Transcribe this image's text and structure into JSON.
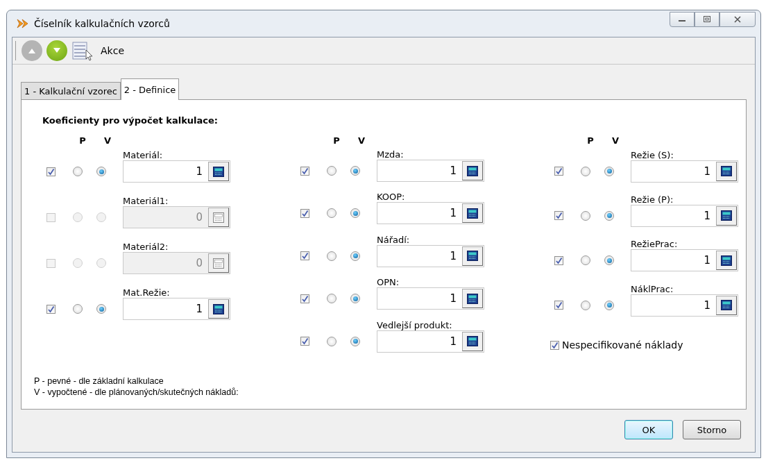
{
  "window": {
    "title": "Číselník kalkulačních vzorců"
  },
  "toolbar": {
    "action_label": "Akce"
  },
  "tabs": [
    {
      "label": "1 - Kalkulační vzorec",
      "selected": false
    },
    {
      "label": "2 - Definice",
      "selected": true
    }
  ],
  "section_title": "Koeficienty pro výpočet kalkulace:",
  "groups": [
    {
      "p_header": "P",
      "v_header": "V",
      "items": [
        {
          "kind": "coef",
          "label": "Materiál:",
          "checked": true,
          "disabled": false,
          "p_selected": false,
          "v_selected": true,
          "value": "1"
        },
        {
          "kind": "coef",
          "label": "Materiál1:",
          "checked": false,
          "disabled": true,
          "p_selected": false,
          "v_selected": false,
          "value": "0"
        },
        {
          "kind": "coef",
          "label": "Materiál2:",
          "checked": false,
          "disabled": true,
          "p_selected": false,
          "v_selected": false,
          "value": "0"
        },
        {
          "kind": "coef",
          "label": "Mat.Režie:",
          "checked": true,
          "disabled": false,
          "p_selected": false,
          "v_selected": true,
          "value": "1"
        }
      ]
    },
    {
      "p_header": "P",
      "v_header": "V",
      "items": [
        {
          "kind": "coef",
          "label": "Mzda:",
          "checked": true,
          "disabled": false,
          "p_selected": false,
          "v_selected": true,
          "value": "1"
        },
        {
          "kind": "coef",
          "label": "KOOP:",
          "checked": true,
          "disabled": false,
          "p_selected": false,
          "v_selected": true,
          "value": "1"
        },
        {
          "kind": "coef",
          "label": "Nářadí:",
          "checked": true,
          "disabled": false,
          "p_selected": false,
          "v_selected": true,
          "value": "1"
        },
        {
          "kind": "coef",
          "label": "OPN:",
          "checked": true,
          "disabled": false,
          "p_selected": false,
          "v_selected": true,
          "value": "1"
        },
        {
          "kind": "coef",
          "label": "Vedlejší produkt:",
          "checked": true,
          "disabled": false,
          "p_selected": false,
          "v_selected": true,
          "value": "1"
        }
      ]
    },
    {
      "p_header": "P",
      "v_header": "V",
      "items": [
        {
          "kind": "coef",
          "label": "Režie (S):",
          "checked": true,
          "disabled": false,
          "p_selected": false,
          "v_selected": true,
          "value": "1"
        },
        {
          "kind": "coef",
          "label": "Režie (P):",
          "checked": true,
          "disabled": false,
          "p_selected": false,
          "v_selected": true,
          "value": "1"
        },
        {
          "kind": "coef",
          "label": "RežiePrac:",
          "checked": true,
          "disabled": false,
          "p_selected": false,
          "v_selected": true,
          "value": "1"
        },
        {
          "kind": "coef",
          "label": "NáklPrac:",
          "checked": true,
          "disabled": false,
          "p_selected": false,
          "v_selected": true,
          "value": "1"
        },
        {
          "kind": "check",
          "label": "Nespecifikované náklady",
          "checked": true
        }
      ]
    }
  ],
  "legend": [
    "P - pevné - dle základní kalkulace",
    "V - vypočtené - dle plánovaných/skutečných nákladů:"
  ],
  "buttons": [
    {
      "label": "OK",
      "default": true
    },
    {
      "label": "Storno",
      "default": false
    }
  ]
}
